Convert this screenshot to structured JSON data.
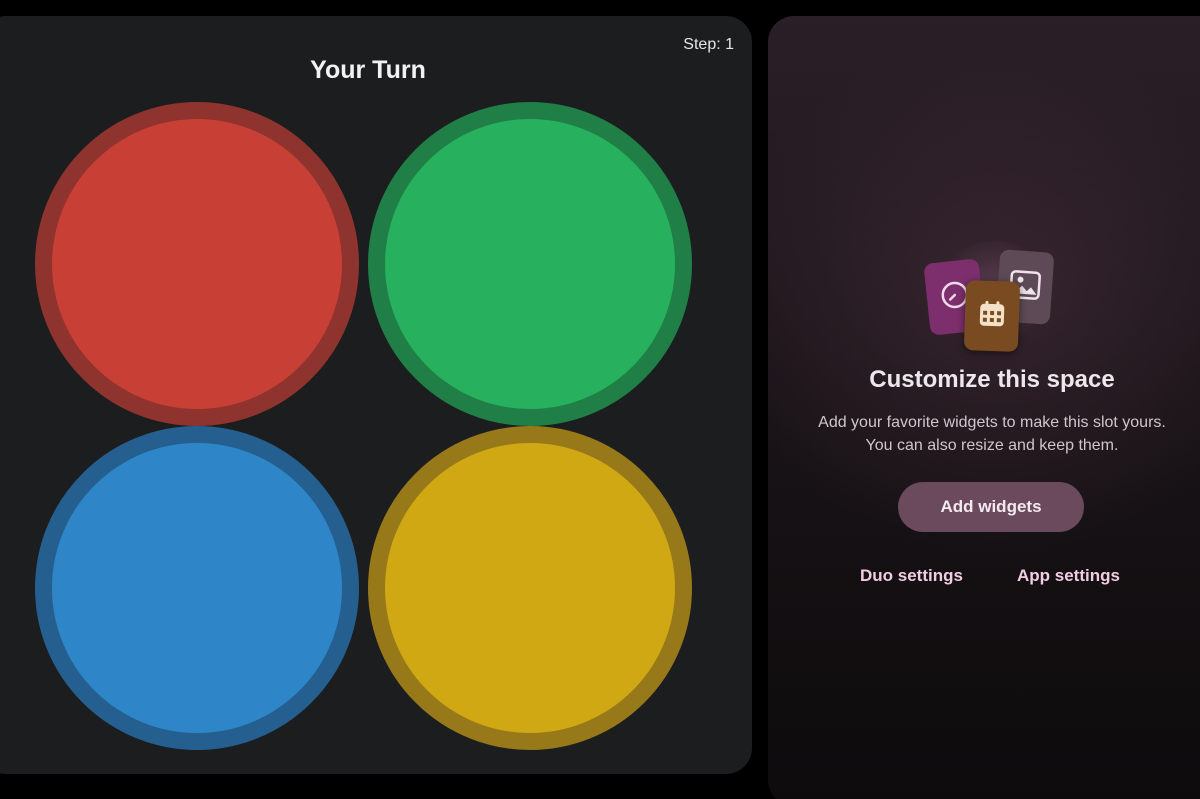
{
  "game": {
    "step_label": "Step: 1",
    "turn_title": "Your Turn",
    "pads": [
      {
        "name": "red",
        "fill": "#c83f35",
        "ring": "#8e332e"
      },
      {
        "name": "green",
        "fill": "#27b05d",
        "ring": "#1f7f46"
      },
      {
        "name": "blue",
        "fill": "#2e86c8",
        "ring": "#245f8f"
      },
      {
        "name": "yellow",
        "fill": "#cfa814",
        "ring": "#97791a"
      }
    ]
  },
  "widget_panel": {
    "icons": [
      "clock-icon",
      "image-icon",
      "calendar-icon"
    ],
    "title": "Customize this space",
    "description_line1": "Add your favorite widgets to make this slot yours.",
    "description_line2": "You can also resize and keep them.",
    "add_button_label": "Add widgets",
    "links": {
      "duo_settings": "Duo settings",
      "app_settings": "App settings"
    },
    "colors": {
      "button_bg": "#6b4a5e",
      "link_text": "#f1cde5"
    }
  }
}
